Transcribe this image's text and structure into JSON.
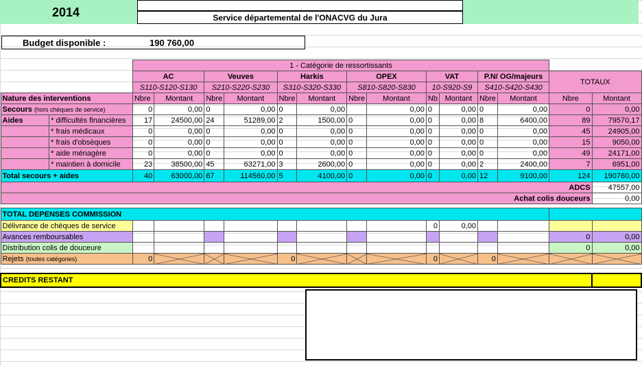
{
  "year": "2014",
  "service_title": "Service départemental de l'ONACVG du Jura",
  "budget": {
    "label": "Budget disponible :",
    "value": "190 760,00"
  },
  "category_title": "1 - Catégorie de ressortissants",
  "groups": [
    {
      "name": "AC",
      "codes": "S110-S120-S130"
    },
    {
      "name": "Veuves",
      "codes": "S210-S220-S230"
    },
    {
      "name": "Harkis",
      "codes": "S310-S320-S330"
    },
    {
      "name": "OPEX",
      "codes": "S810-S820-S830"
    },
    {
      "name": "VAT",
      "codes": "10-S920-S9"
    },
    {
      "name": "P.N/ OG/majeurs",
      "codes": "S410-S420-S430"
    }
  ],
  "totaux_label": "TOTAUX",
  "col_nbre": "Nbre",
  "col_montant": "Montant",
  "col_nb_short": "Nb",
  "nature_label": "Nature des interventions",
  "secours": {
    "label": "Secours",
    "sublabel": "(hors chèques de service)",
    "cells": [
      [
        "0",
        "0,00"
      ],
      [
        "0",
        "0,00"
      ],
      [
        "0",
        "0,00"
      ],
      [
        "",
        "0,00"
      ],
      [
        "0",
        "0,00"
      ],
      [
        "0",
        "0,00"
      ]
    ],
    "total": [
      "0",
      "0,00"
    ]
  },
  "aides_label": "Aides",
  "aides": [
    {
      "label": "* difficultés financières",
      "cells": [
        [
          "17",
          "24500,00"
        ],
        [
          "24",
          "51289,00"
        ],
        [
          "2",
          "1500,00"
        ],
        [
          "0",
          "0,00"
        ],
        [
          "0",
          "0,00"
        ],
        [
          "8",
          "6400,00"
        ]
      ],
      "total": [
        "89",
        "79570,17"
      ]
    },
    {
      "label": "* frais médicaux",
      "cells": [
        [
          "0",
          "0,00"
        ],
        [
          "0",
          "0,00"
        ],
        [
          "0",
          "0,00"
        ],
        [
          "0",
          "0,00"
        ],
        [
          "0",
          "0,00"
        ],
        [
          "0",
          "0,00"
        ]
      ],
      "total": [
        "45",
        "24905,00"
      ]
    },
    {
      "label": "* frais d'obsèques",
      "cells": [
        [
          "0",
          "0,00"
        ],
        [
          "0",
          "0,00"
        ],
        [
          "0",
          "0,00"
        ],
        [
          "0",
          "0,00"
        ],
        [
          "0",
          "0,00"
        ],
        [
          "0",
          "0,00"
        ]
      ],
      "total": [
        "15",
        "9050,00"
      ]
    },
    {
      "label": "* aide ménagère",
      "cells": [
        [
          "0",
          "0,00"
        ],
        [
          "0",
          "0,00"
        ],
        [
          "0",
          "0,00"
        ],
        [
          "0",
          "0,00"
        ],
        [
          "0",
          "0,00"
        ],
        [
          "0",
          "0,00"
        ]
      ],
      "total": [
        "49",
        "24171,00"
      ]
    },
    {
      "label": "* maintien à domicile",
      "cells": [
        [
          "23",
          "38500,00"
        ],
        [
          "45",
          "63271,00"
        ],
        [
          "3",
          "2600,00"
        ],
        [
          "0",
          "0,00"
        ],
        [
          "0",
          "0,00"
        ],
        [
          "2",
          "2400,00"
        ]
      ],
      "total": [
        "7",
        "6951,00"
      ]
    }
  ],
  "total_row": {
    "label": "Total secours + aides",
    "cells": [
      [
        "40",
        "63000,00"
      ],
      [
        "67",
        "114560,00"
      ],
      [
        "5",
        "4100,00"
      ],
      [
        "0",
        "0,00"
      ],
      [
        "0",
        "0,00"
      ],
      [
        "12",
        "9100,00"
      ]
    ],
    "total": [
      "124",
      "190760,00"
    ]
  },
  "adcs": {
    "label": "ADCS",
    "value": "47557,00"
  },
  "colis": {
    "label": "Achat colis douceurs",
    "value": "0,00"
  },
  "total_depenses": "TOTAL DEPENSES COMMISSION",
  "delivrance": {
    "label": "Délivrance de chèques de service",
    "vat": [
      "0",
      "0,00"
    ]
  },
  "avances": {
    "label": "Avances remboursables",
    "total": [
      "0",
      "0,00"
    ]
  },
  "distribution": {
    "label": "Distribution colis de douceure",
    "total": [
      "0",
      "0,00"
    ]
  },
  "rejets": {
    "label": "Rejets",
    "sublabel": "(toutes catégories)",
    "vals": [
      "0",
      "0",
      "0",
      "0"
    ]
  },
  "credits_restant": "CREDITS RESTANT"
}
